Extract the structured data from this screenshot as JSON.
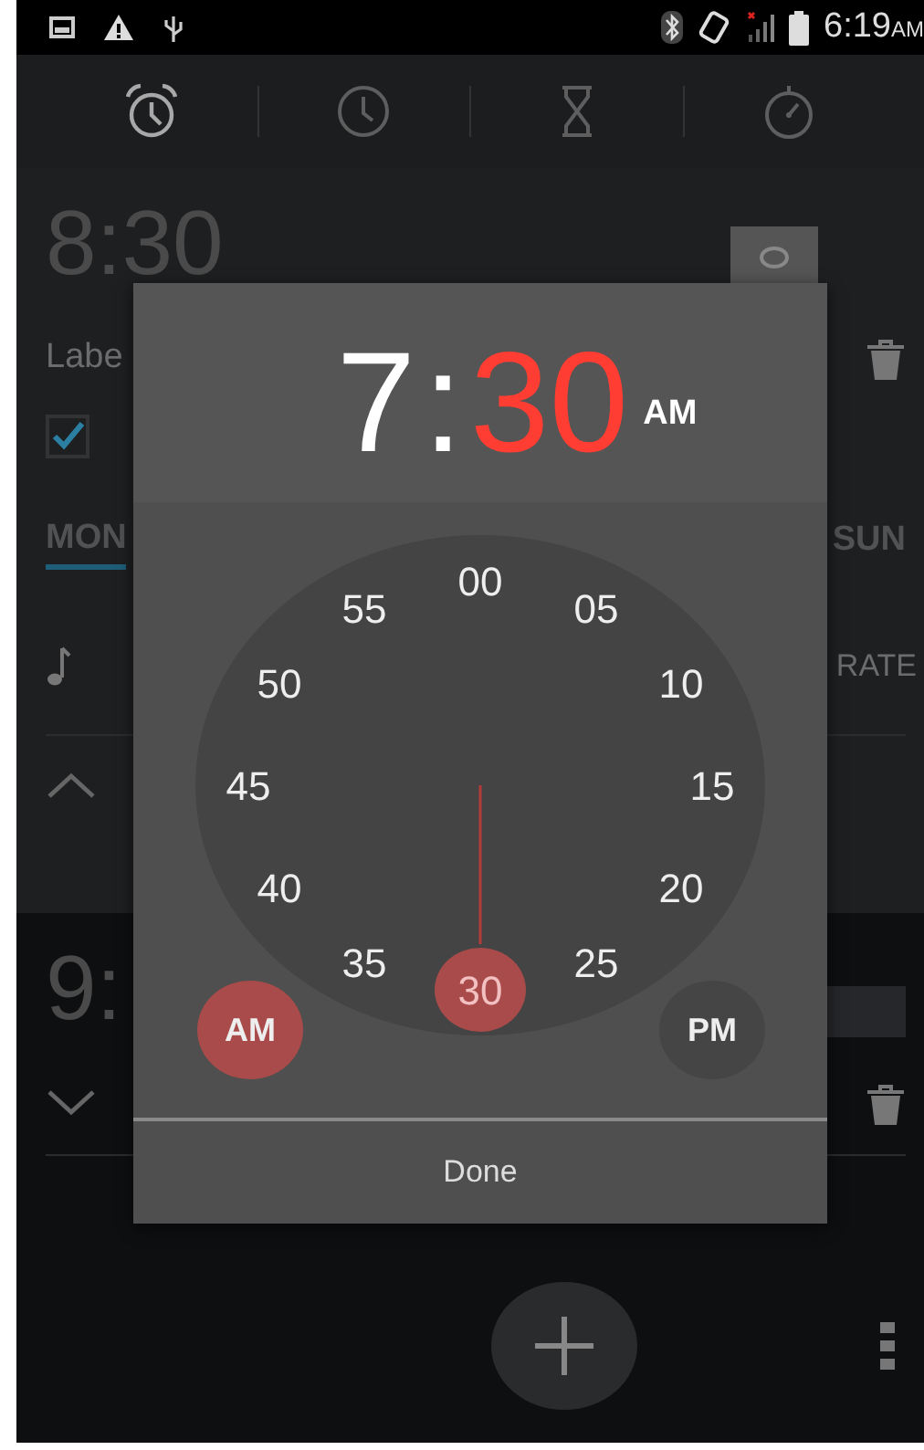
{
  "status_bar": {
    "time": "6:19",
    "time_suffix": "AM"
  },
  "tabs": [
    {
      "kind": "alarm",
      "selected": true
    },
    {
      "kind": "clock",
      "selected": false
    },
    {
      "kind": "timer",
      "selected": false
    },
    {
      "kind": "stopwatch",
      "selected": false
    }
  ],
  "alarms": [
    {
      "time": "8:30",
      "switch_on": false,
      "expanded": true,
      "label": "Labe",
      "repeat_checked": true,
      "day_first": "MON",
      "day_last": "SUN",
      "vibrate_text": "RATE"
    },
    {
      "time": "9:",
      "switch_on": false,
      "expanded": false
    }
  ],
  "time_picker": {
    "hour": {
      "text": "7",
      "active": false
    },
    "separator": ":",
    "minute": {
      "text": "30",
      "active": true
    },
    "ampm": "AM",
    "minute_labels": [
      {
        "text": "00",
        "selected": false
      },
      {
        "text": "05",
        "selected": false
      },
      {
        "text": "10",
        "selected": false
      },
      {
        "text": "15",
        "selected": false
      },
      {
        "text": "20",
        "selected": false
      },
      {
        "text": "25",
        "selected": false
      },
      {
        "text": "30",
        "selected": true
      },
      {
        "text": "35",
        "selected": false
      },
      {
        "text": "40",
        "selected": false
      },
      {
        "text": "45",
        "selected": false
      },
      {
        "text": "50",
        "selected": false
      },
      {
        "text": "55",
        "selected": false
      }
    ],
    "am": {
      "label": "AM",
      "selected": true
    },
    "pm": {
      "label": "PM",
      "selected": false
    },
    "done": "Done"
  }
}
